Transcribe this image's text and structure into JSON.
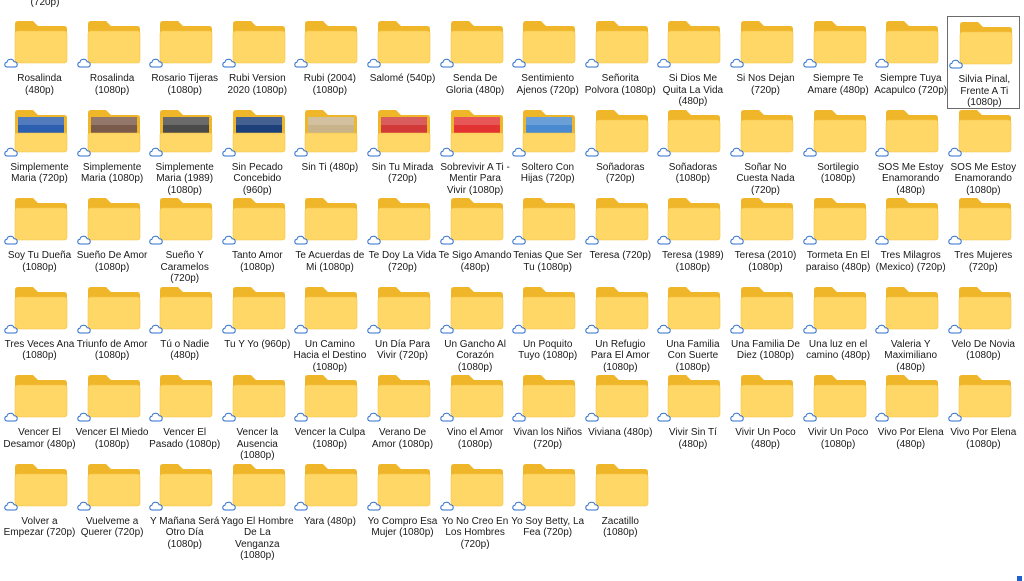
{
  "top_fragment": "(720p)",
  "folders": [
    {
      "label": "Rosalinda (480p)",
      "thumb": "",
      "selected": false
    },
    {
      "label": "Rosalinda (1080p)",
      "thumb": "",
      "selected": false
    },
    {
      "label": "Rosario Tijeras (1080p)",
      "thumb": "",
      "selected": false
    },
    {
      "label": "Rubi  Version 2020 (1080p)",
      "thumb": "",
      "selected": false
    },
    {
      "label": "Rubi (2004) (1080p)",
      "thumb": "",
      "selected": false
    },
    {
      "label": "Salomé (540p)",
      "thumb": "",
      "selected": false
    },
    {
      "label": "Senda De Gloria (480p)",
      "thumb": "",
      "selected": false
    },
    {
      "label": "Sentimiento Ajenos (720p)",
      "thumb": "",
      "selected": false
    },
    {
      "label": "Señorita Polvora (1080p)",
      "thumb": "",
      "selected": false
    },
    {
      "label": "Si Dios Me Quita La Vida (480p)",
      "thumb": "",
      "selected": false
    },
    {
      "label": "Si Nos Dejan (720p)",
      "thumb": "",
      "selected": false
    },
    {
      "label": "Siempre Te Amare (480p)",
      "thumb": "",
      "selected": false
    },
    {
      "label": "Siempre Tuya Acapulco (720p)",
      "thumb": "",
      "selected": false
    },
    {
      "label": "Silvia Pinal, Frente A Ti (1080p)",
      "thumb": "",
      "selected": true
    },
    {
      "label": "Simplemente Maria (720p)",
      "thumb": "#2c5fb0",
      "selected": false
    },
    {
      "label": "Simplemente Maria (1080p)",
      "thumb": "#7a5a4a",
      "selected": false
    },
    {
      "label": "Simplemente Maria (1989) (1080p)",
      "thumb": "#4a4a4a",
      "selected": false
    },
    {
      "label": "Sin Pecado Concebido (960p)",
      "thumb": "#1d3f7a",
      "selected": false
    },
    {
      "label": "Sin Ti (480p)",
      "thumb": "#c9b38a",
      "selected": false
    },
    {
      "label": "Sin Tu Mirada (720p)",
      "thumb": "#d23a3a",
      "selected": false
    },
    {
      "label": "Sobrevivir A Ti - Mentir Para Vivir (1080p)",
      "thumb": "#e23232",
      "selected": false
    },
    {
      "label": "Soltero Con Hijas (720p)",
      "thumb": "#4a8ad0",
      "selected": false
    },
    {
      "label": "Soñadoras (720p)",
      "thumb": "",
      "selected": false
    },
    {
      "label": "Soñadoras (1080p)",
      "thumb": "",
      "selected": false
    },
    {
      "label": "Soñar No Cuesta Nada (720p)",
      "thumb": "",
      "selected": false
    },
    {
      "label": "Sortilegio (1080p)",
      "thumb": "",
      "selected": false
    },
    {
      "label": "SOS Me Estoy Enamorando (480p)",
      "thumb": "",
      "selected": false
    },
    {
      "label": "SOS Me Estoy Enamorando (1080p)",
      "thumb": "",
      "selected": false
    },
    {
      "label": "Soy Tu Dueña (1080p)",
      "thumb": "",
      "selected": false
    },
    {
      "label": "Sueño De Amor (1080p)",
      "thumb": "",
      "selected": false
    },
    {
      "label": "Sueño Y Caramelos (720p)",
      "thumb": "",
      "selected": false
    },
    {
      "label": "Tanto Amor (1080p)",
      "thumb": "",
      "selected": false
    },
    {
      "label": "Te Acuerdas de Mi (1080p)",
      "thumb": "",
      "selected": false
    },
    {
      "label": "Te Doy La Vida (720p)",
      "thumb": "",
      "selected": false
    },
    {
      "label": "Te Sigo Amando (480p)",
      "thumb": "",
      "selected": false
    },
    {
      "label": "Tenias Que Ser Tu (1080p)",
      "thumb": "",
      "selected": false
    },
    {
      "label": "Teresa (720p)",
      "thumb": "",
      "selected": false
    },
    {
      "label": "Teresa (1989) (1080p)",
      "thumb": "",
      "selected": false
    },
    {
      "label": "Teresa (2010) (1080p)",
      "thumb": "",
      "selected": false
    },
    {
      "label": "Tormeta En El paraiso (480p)",
      "thumb": "",
      "selected": false
    },
    {
      "label": "Tres Milagros (Mexico) (720p)",
      "thumb": "",
      "selected": false
    },
    {
      "label": "Tres Mujeres (720p)",
      "thumb": "",
      "selected": false
    },
    {
      "label": "Tres Veces Ana (1080p)",
      "thumb": "",
      "selected": false
    },
    {
      "label": "Triunfo de Amor (1080p)",
      "thumb": "",
      "selected": false
    },
    {
      "label": "Tú o Nadie (480p)",
      "thumb": "",
      "selected": false
    },
    {
      "label": "Tu Y Yo (960p)",
      "thumb": "",
      "selected": false
    },
    {
      "label": "Un Camino Hacia el Destino (1080p)",
      "thumb": "",
      "selected": false
    },
    {
      "label": "Un Día Para Vivir (720p)",
      "thumb": "",
      "selected": false
    },
    {
      "label": "Un Gancho Al Corazón (1080p)",
      "thumb": "",
      "selected": false
    },
    {
      "label": "Un Poquito Tuyo (1080p)",
      "thumb": "",
      "selected": false
    },
    {
      "label": "Un Refugio Para El Amor (1080p)",
      "thumb": "",
      "selected": false
    },
    {
      "label": "Una Familia Con Suerte (1080p)",
      "thumb": "",
      "selected": false
    },
    {
      "label": "Una Familia De Diez (1080p)",
      "thumb": "",
      "selected": false
    },
    {
      "label": "Una luz en el camino (480p)",
      "thumb": "",
      "selected": false
    },
    {
      "label": "Valeria Y Maximiliano (480p)",
      "thumb": "",
      "selected": false
    },
    {
      "label": "Velo De Novia (1080p)",
      "thumb": "",
      "selected": false
    },
    {
      "label": "Vencer El Desamor (480p)",
      "thumb": "",
      "selected": false
    },
    {
      "label": "Vencer El Miedo (1080p)",
      "thumb": "",
      "selected": false
    },
    {
      "label": "Vencer El Pasado (1080p)",
      "thumb": "",
      "selected": false
    },
    {
      "label": "Vencer la Ausencia (1080p)",
      "thumb": "",
      "selected": false
    },
    {
      "label": "Vencer la Culpa (1080p)",
      "thumb": "",
      "selected": false
    },
    {
      "label": "Verano De Amor (1080p)",
      "thumb": "",
      "selected": false
    },
    {
      "label": "Vino el Amor (1080p)",
      "thumb": "",
      "selected": false
    },
    {
      "label": "Vivan los Niños (720p)",
      "thumb": "",
      "selected": false
    },
    {
      "label": "Viviana (480p)",
      "thumb": "",
      "selected": false
    },
    {
      "label": "Vivir Sin Tí (480p)",
      "thumb": "",
      "selected": false
    },
    {
      "label": "Vivir Un Poco (480p)",
      "thumb": "",
      "selected": false
    },
    {
      "label": "Vivir Un Poco (1080p)",
      "thumb": "",
      "selected": false
    },
    {
      "label": "Vivo Por Elena (480p)",
      "thumb": "",
      "selected": false
    },
    {
      "label": "Vivo Por Elena (1080p)",
      "thumb": "",
      "selected": false
    },
    {
      "label": "Volver a Empezar (720p)",
      "thumb": "",
      "selected": false
    },
    {
      "label": "Vuelveme a Querer (720p)",
      "thumb": "",
      "selected": false
    },
    {
      "label": "Y Mañana Será Otro Día (1080p)",
      "thumb": "",
      "selected": false
    },
    {
      "label": "Yago El Hombre De La Venganza (1080p)",
      "thumb": "",
      "selected": false
    },
    {
      "label": "Yara (480p)",
      "thumb": "",
      "selected": false
    },
    {
      "label": "Yo Compro Esa Mujer (1080p)",
      "thumb": "",
      "selected": false
    },
    {
      "label": "Yo No Creo En Los Hombres (720p)",
      "thumb": "",
      "selected": false
    },
    {
      "label": "Yo Soy Betty, La Fea (720p)",
      "thumb": "",
      "selected": false
    },
    {
      "label": "Zacatillo (1080p)",
      "thumb": "",
      "selected": false
    }
  ],
  "colors": {
    "folder_back": "#f0b62a",
    "folder_front": "#ffd766",
    "folder_front_edge": "#f5c548",
    "cloud_stroke": "#2f6fcf",
    "selection_border": "#6b6b6b"
  },
  "icons": {
    "folder": "folder-icon",
    "cloud": "cloud-status-icon"
  }
}
